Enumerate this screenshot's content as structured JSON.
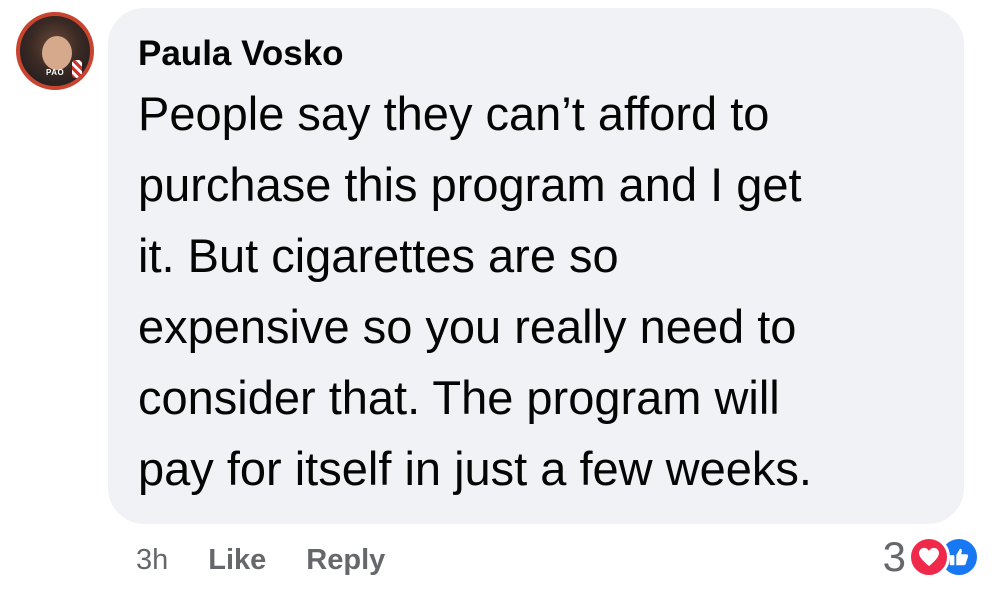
{
  "comment": {
    "author": "Paula Vosko",
    "avatar_badge_text": "PAO",
    "text": "People say they can’t afford to\npurchase this program and I get\nit. But cigarettes are so\nexpensive so you really need to\nconsider that. The program will\npay for itself in just a few weeks.",
    "timestamp": "3h",
    "like_label": "Like",
    "reply_label": "Reply",
    "reaction_count": "3",
    "reaction_icons": [
      "heart-icon",
      "like-icon"
    ]
  },
  "colors": {
    "bubble_bg": "#f0f2f5",
    "text": "#050505",
    "secondary_text": "#65676b",
    "love_red": "#f0284a",
    "like_blue": "#1877f2"
  }
}
